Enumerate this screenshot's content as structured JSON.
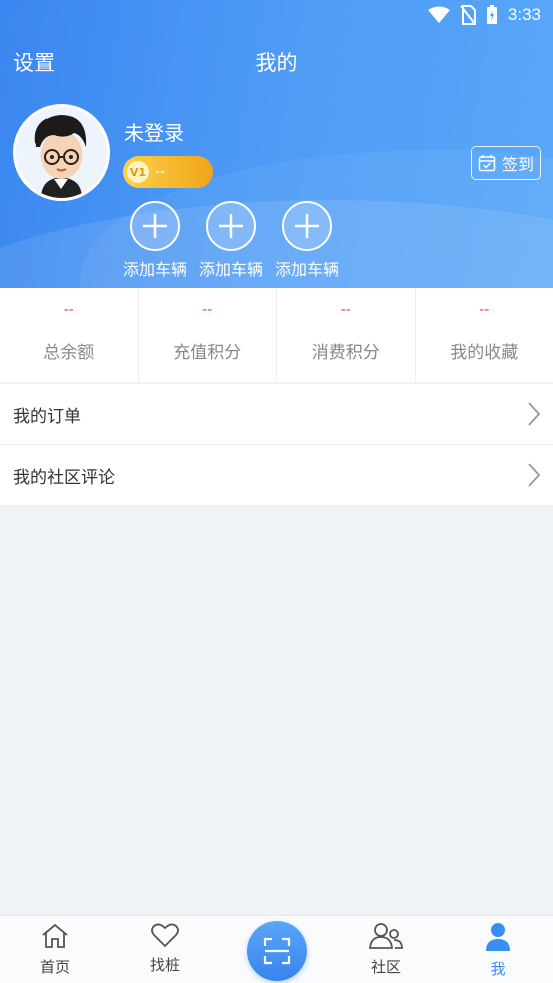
{
  "status_bar": {
    "time": "3:33"
  },
  "header": {
    "settings_label": "设置",
    "title": "我的",
    "user_name": "未登录",
    "level_badge_icon": "V1",
    "level_value": "--",
    "checkin_label": "签到"
  },
  "vehicles": [
    {
      "label": "添加车辆"
    },
    {
      "label": "添加车辆"
    },
    {
      "label": "添加车辆"
    }
  ],
  "stats": [
    {
      "value": "--",
      "label": "总余额"
    },
    {
      "value": "--",
      "label": "充值积分"
    },
    {
      "value": "--",
      "label": "消费积分"
    },
    {
      "value": "--",
      "label": "我的收藏"
    }
  ],
  "menu": [
    {
      "label": "我的订单"
    },
    {
      "label": "我的社区评论"
    }
  ],
  "tabs": [
    {
      "label": "首页",
      "icon": "home-icon"
    },
    {
      "label": "找桩",
      "icon": "heart-icon"
    },
    {
      "label": "",
      "icon": "scan-icon"
    },
    {
      "label": "社区",
      "icon": "community-icon"
    },
    {
      "label": "我",
      "icon": "person-icon",
      "active": true
    }
  ],
  "colors": {
    "accent": "#3a8ef2",
    "stat_value": "#ee3b3b",
    "badge": "#f0a41a"
  }
}
